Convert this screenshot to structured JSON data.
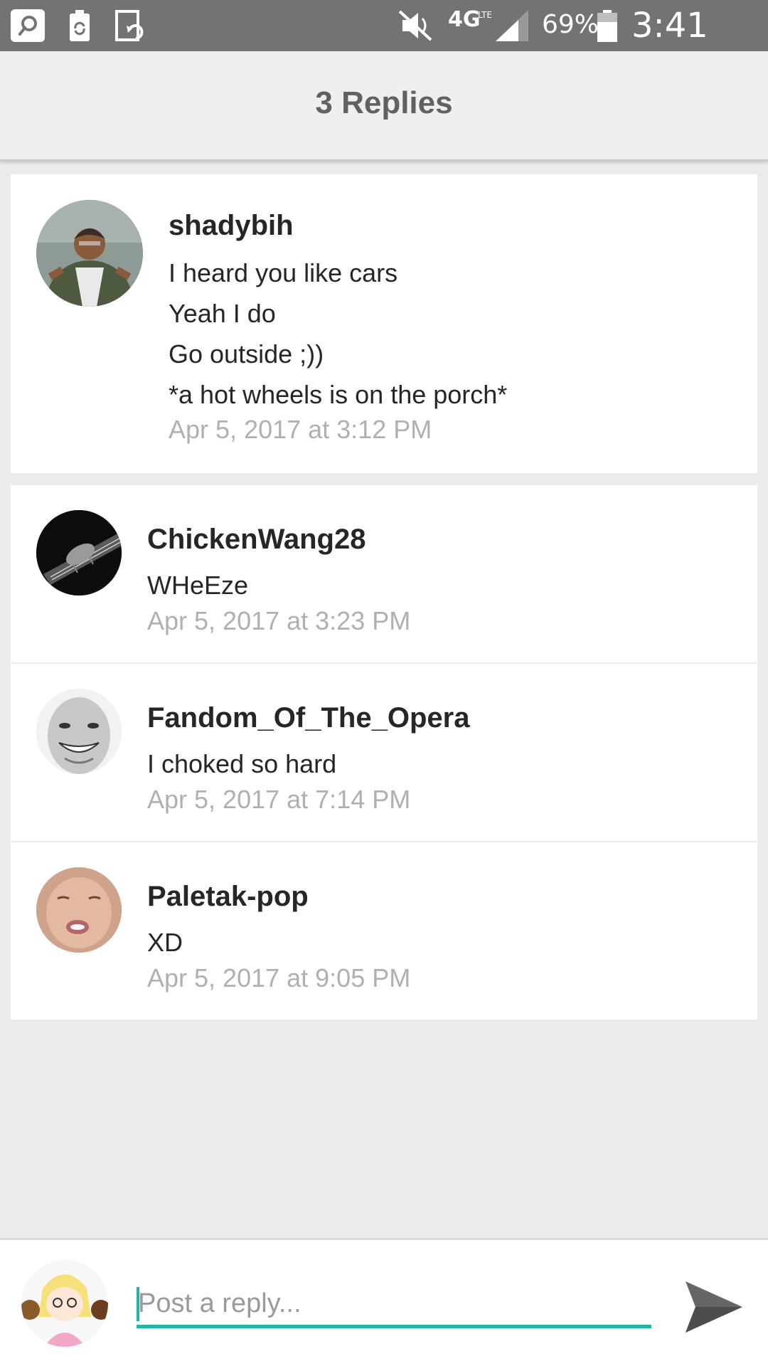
{
  "status_bar": {
    "signal_label": "4G",
    "lte_label": "LTE",
    "battery_percent": "69%",
    "time": "3:41 PM",
    "battery_level": 0.69,
    "icons": [
      "search-icon",
      "battery-recycle-icon",
      "screen-rotate-icon",
      "mute-icon",
      "signal-icon",
      "battery-icon"
    ]
  },
  "header": {
    "title": "3 Replies"
  },
  "parent_comment": {
    "username": "shadybih",
    "lines": [
      "I heard you like cars",
      "Yeah I do",
      "Go outside ;))",
      "*a hot wheels is on the porch*"
    ],
    "timestamp": "Apr 5, 2017 at 3:12 PM"
  },
  "replies": [
    {
      "username": "ChickenWang28",
      "text": "WHeEze",
      "timestamp": "Apr 5, 2017 at 3:23 PM"
    },
    {
      "username": "Fandom_Of_The_Opera",
      "text": "I choked so hard",
      "timestamp": "Apr 5, 2017 at 7:14 PM"
    },
    {
      "username": "Paletak-pop",
      "text": "XD",
      "timestamp": "Apr 5, 2017 at 9:05 PM"
    }
  ],
  "reply_bar": {
    "placeholder": "Post a reply...",
    "accent_color": "#1fb6a6"
  },
  "colors": {
    "status_bar": "#737373",
    "header_bg": "#efefef",
    "page_bg": "#ececec",
    "timestamp": "#b0b0b0"
  }
}
